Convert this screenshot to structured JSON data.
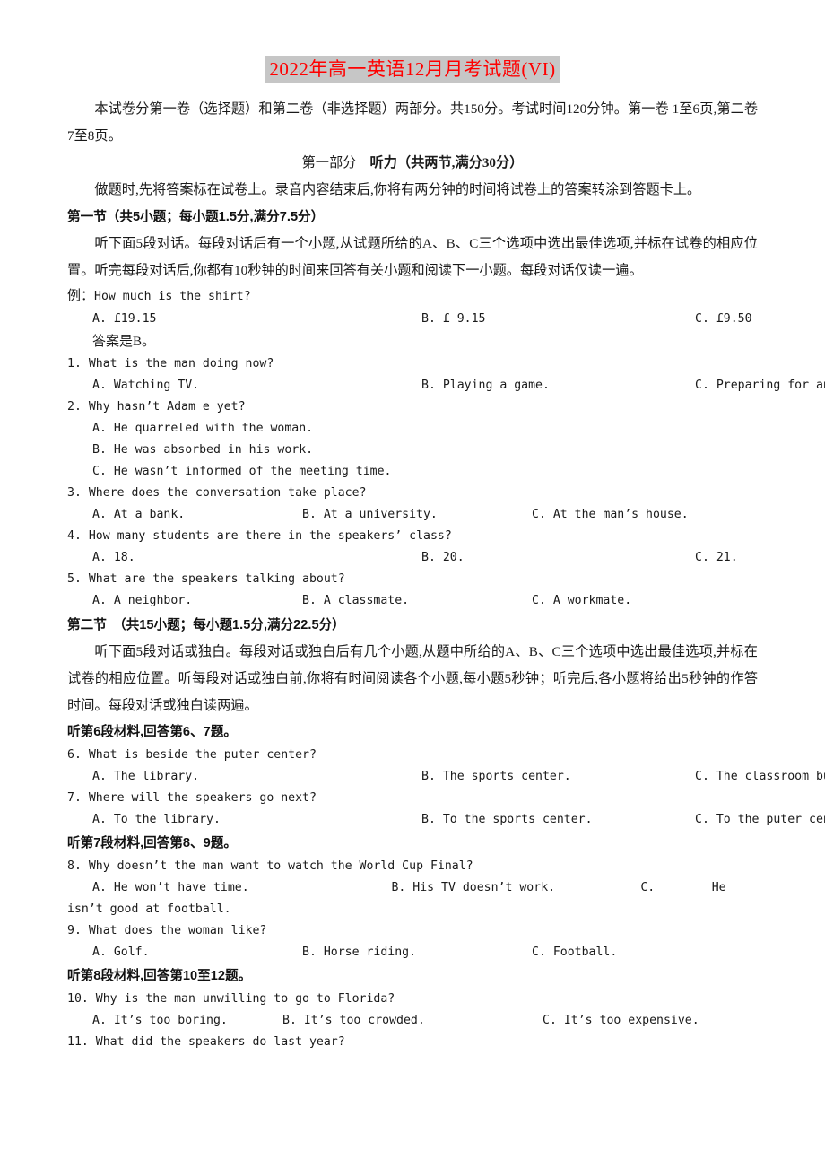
{
  "document": {
    "title": "2022年高一英语12月月考试题(VI)",
    "title_color": "#ff0000",
    "title_highlight": "#c6c6c6"
  },
  "intro": {
    "line1": "本试卷分第一卷（选择题）和第二卷（非选择题）两部分。共150分。考试时间120分钟。第一卷 1至6页,第二卷7至8页。"
  },
  "part1": {
    "label": "第一部分",
    "heading": "听力（共两节,满分30分）",
    "instruction": "做题时,先将答案标在试卷上。录音内容结束后,你将有两分钟的时间将试卷上的答案转涂到答题卡上。"
  },
  "section1": {
    "heading": "第一节（共5小题；每小题1.5分,满分7.5分）",
    "instruction": "听下面5段对话。每段对话后有一个小题,从试题所给的A、B、C三个选项中选出最佳选项,并标在试卷的相应位置。听完每段对话后,你都有10秒钟的时间来回答有关小题和阅读下一小题。每段对话仅读一遍。",
    "example": {
      "prefix": "例：",
      "question": "How much is the shirt?",
      "options": [
        "A. £19.15",
        "B. £ 9.15",
        "C. £9.50"
      ],
      "answer": "答案是B。"
    },
    "questions": [
      {
        "number": "1.",
        "text": "What is the man doing now?",
        "options": [
          "A. Watching TV.",
          "B. Playing a game.",
          "C. Preparing for an exam."
        ],
        "layout": "wide"
      },
      {
        "number": "2.",
        "text": "Why hasn’t Adam e yet?",
        "stacked_options": [
          "A. He quarreled with the woman.",
          "B. He was absorbed in his work.",
          "C. He wasn’t informed of the meeting time."
        ]
      },
      {
        "number": "3.",
        "text": "Where does the conversation take place?",
        "options": [
          "A. At a bank.",
          "B. At a university.",
          "C. At the man’s house."
        ],
        "layout": "wide"
      },
      {
        "number": "4.",
        "text": "How many students are there in the speakers’ class?",
        "options": [
          "A. 18.",
          "B. 20.",
          "C. 21."
        ],
        "layout": "wide"
      },
      {
        "number": "5.",
        "text": "What are the speakers talking about?",
        "options": [
          "A. A neighbor.",
          "B. A classmate.",
          "C. A workmate."
        ],
        "layout": "wide"
      }
    ]
  },
  "section2": {
    "heading": "第二节　（共15小题；每小题1.5分,满分22.5分）",
    "instruction": "听下面5段对话或独白。每段对话或独白后有几个小题,从题中所给的A、B、C三个选项中选出最佳选项,并标在试卷的相应位置。听每段对话或独白前,你将有时间阅读各个小题,每小题5秒钟；听完后,各小题将给出5秒钟的作答时间。每段对话或独白读两遍。",
    "materials": [
      {
        "heading": "听第6段材料,回答第6、7题。",
        "questions": [
          {
            "number": "6.",
            "text": "What is beside the puter center?",
            "options": [
              "A. The library.",
              "B. The sports center.",
              "C. The classroom building."
            ],
            "layout": "wide"
          },
          {
            "number": "7.",
            "text": "Where will the speakers go next?",
            "options": [
              "A. To the library.",
              "B. To the sports center.",
              "C. To the puter center."
            ],
            "layout": "wide"
          }
        ]
      },
      {
        "heading": "听第7段材料,回答第8、9题。",
        "questions": [
          {
            "number": "8.",
            "text": "Why doesn’t the man want to watch the World Cup Final?",
            "flow_options_line1": "A. He won’t have time.                    B. His TV doesn’t work.            C.        He",
            "flow_options_line2": "isn’t good at football."
          },
          {
            "number": "9.",
            "text": "What does the woman like?",
            "options": [
              "A. Golf.",
              "B. Horse riding.",
              "C. Football."
            ],
            "layout": "normal"
          }
        ]
      },
      {
        "heading": "听第8段材料,回答第10至12题。",
        "questions": [
          {
            "number": "10.",
            "text": "Why is the man unwilling to go to Florida?",
            "options": [
              "A. It’s too boring.",
              "B. It’s too crowded.",
              "C. It’s too expensive."
            ],
            "layout": "wide"
          },
          {
            "number": "11.",
            "text": "What did the speakers do last year?",
            "options": null
          }
        ]
      }
    ]
  }
}
